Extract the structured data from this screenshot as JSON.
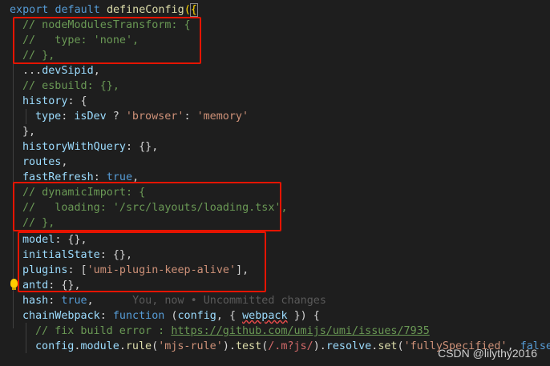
{
  "code": {
    "l1": {
      "a": "export",
      "b": "default",
      "c": "defineConfig",
      "d": "(",
      "e": "{"
    },
    "l2": "// nodeModulesTransform: {",
    "l3": "//   type: 'none',",
    "l4": "// },",
    "l5": {
      "a": "...",
      "b": "devSipid",
      "c": ","
    },
    "l6": "// esbuild: {},",
    "l7": {
      "a": "history",
      "b": ": {"
    },
    "l8": {
      "a": "type",
      "b": ": ",
      "c": "isDev",
      "d": " ? ",
      "e": "'browser'",
      "f": ": ",
      "g": "'memory'"
    },
    "l9": "},",
    "l10": {
      "a": "historyWithQuery",
      "b": ": {},"
    },
    "l11": {
      "a": "routes",
      "b": ","
    },
    "l12": {
      "a": "fastRefresh",
      "b": ": ",
      "c": "true",
      "d": ","
    },
    "l13": "// dynamicImport: {",
    "l14": "//   loading: '/src/layouts/loading.tsx',",
    "l15": "// },",
    "l16": {
      "a": "model",
      "b": ": {},"
    },
    "l17": {
      "a": "initialState",
      "b": ": {},"
    },
    "l18": {
      "a": "plugins",
      "b": ": [",
      "c": "'umi-plugin-keep-alive'",
      "d": "],"
    },
    "l19": {
      "a": "antd",
      "b": ": {},"
    },
    "l20": {
      "a": "hash",
      "b": ": ",
      "c": "true",
      "d": ",",
      "ghost": "You, now • Uncommitted changes"
    },
    "l21": {
      "a": "chainWebpack",
      "b": ": ",
      "c": "function",
      "d": " (",
      "e": "config",
      "f": ", { ",
      "g": "webpack",
      "h": " }) {"
    },
    "l22": {
      "a": "// fix build error : ",
      "b": "https://github.com/umijs/umi/issues/7935"
    },
    "l23": {
      "a": "config",
      "b": ".",
      "c": "module",
      "d": ".",
      "e": "rule",
      "f": "(",
      "g": "'mjs-rule'",
      "h": ").",
      "i": "test",
      "j": "(",
      "k": "/.m?js/",
      "l": ").",
      "m": "resolve",
      "n": ".",
      "o": "set",
      "p": "(",
      "q": "'fullySpecified'",
      "r": ", ",
      "s": "false",
      "t": ")"
    }
  },
  "watermark": "CSDN @lilythy2016",
  "colors": {
    "highlight": "#e51400",
    "background": "#1e1e1e"
  }
}
